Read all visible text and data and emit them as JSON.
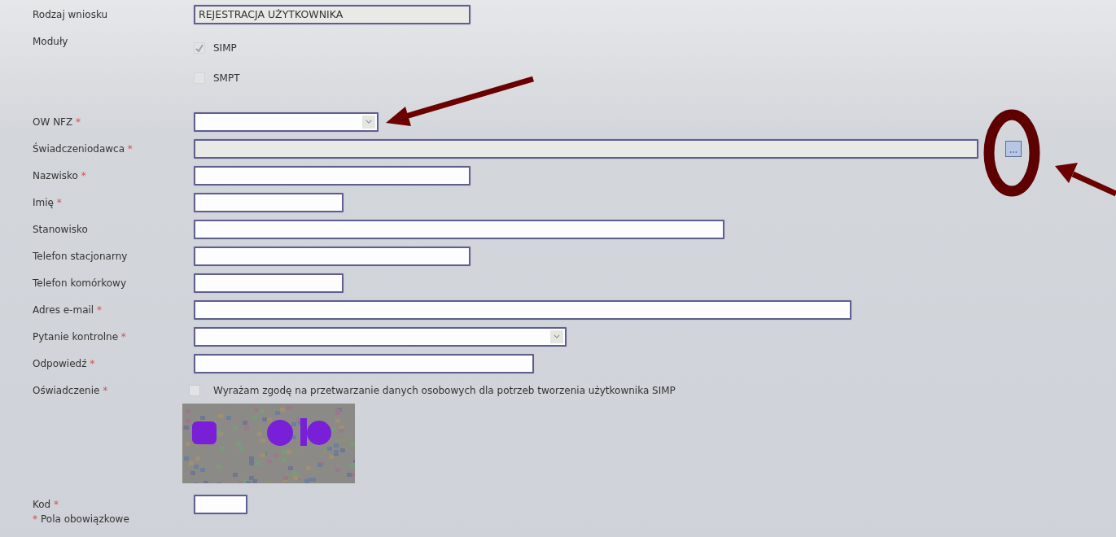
{
  "request_type": {
    "label": "Rodzaj wniosku",
    "value": "REJESTRACJA UŻYTKOWNIKA",
    "disabled": true
  },
  "modules": {
    "label": "Moduły",
    "items": [
      {
        "label": "SIMP",
        "checked": true,
        "disabled": true
      },
      {
        "label": "SMPT",
        "checked": false,
        "disabled": true
      }
    ]
  },
  "fields": [
    {
      "label": "OW NFZ",
      "required": true,
      "kind": "select",
      "disabled": false
    },
    {
      "label": "Świadczeniodawca",
      "required": true,
      "kind": "lookup",
      "disabled": true
    },
    {
      "label": "Nazwisko",
      "required": true,
      "kind": "text",
      "disabled": false
    },
    {
      "label": "Imię",
      "required": true,
      "kind": "text",
      "disabled": false
    },
    {
      "label": "Stanowisko",
      "required": false,
      "kind": "text",
      "disabled": false
    },
    {
      "label": "Telefon stacjonarny",
      "required": false,
      "kind": "text",
      "disabled": false
    },
    {
      "label": "Telefon komórkowy",
      "required": false,
      "kind": "text",
      "disabled": false
    },
    {
      "label": "Adres e-mail",
      "required": true,
      "kind": "text",
      "disabled": false
    },
    {
      "label": "Pytanie kontrolne",
      "required": true,
      "kind": "select",
      "disabled": false
    },
    {
      "label": "Odpowiedź",
      "required": true,
      "kind": "text",
      "disabled": false
    }
  ],
  "consent": {
    "label": "Oświadczenie",
    "required": true,
    "checked": false,
    "text": "Wyrażam zgodę na przetwarzanie danych osobowych dla potrzeb tworzenia użytkownika  SIMP"
  },
  "code": {
    "label": "Kod",
    "required": true
  },
  "footer": {
    "mark": "*",
    "text": "Pola obowiązkowe"
  }
}
